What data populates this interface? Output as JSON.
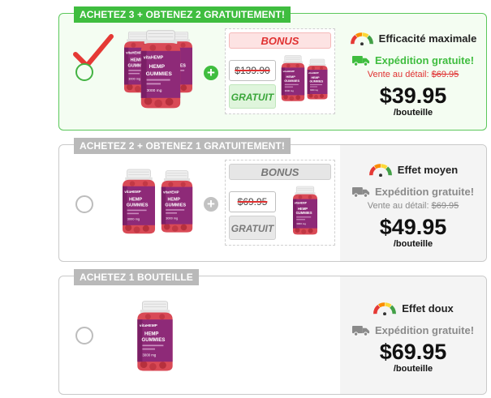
{
  "offers": [
    {
      "ribbon": "ACHETEZ 3 + OBTENEZ 2 GRATUITEMENT!",
      "selected": true,
      "bonus_label": "BONUS",
      "strike_price": "$139.90",
      "free_label": "GRATUIT",
      "effect": "Efficacité maximale",
      "shipping": "Expédition gratuite!",
      "retail_prefix": "Vente au détail:",
      "retail_price": "$69.95",
      "price": "$39.95",
      "per": "/bouteille"
    },
    {
      "ribbon": "ACHETEZ 2 + OBTENEZ 1 GRATUITEMENT!",
      "selected": false,
      "bonus_label": "BONUS",
      "strike_price": "$69.95",
      "free_label": "GRATUIT",
      "effect": "Effet moyen",
      "shipping": "Expédition gratuite!",
      "retail_prefix": "Vente au détail:",
      "retail_price": "$69.95",
      "price": "$49.95",
      "per": "/bouteille"
    },
    {
      "ribbon": "ACHETEZ 1 BOUTEILLE",
      "selected": false,
      "effect": "Effet doux",
      "shipping": "Expédition gratuite!",
      "price": "$69.95",
      "per": "/bouteille"
    }
  ],
  "product": {
    "brand": "vitaHEMP",
    "line1": "HEMP",
    "line2": "GUMMIES",
    "dose": "3000 mg"
  },
  "icons": {
    "checkmark": "red-checkmark-icon",
    "plus": "plus-icon",
    "gauge": "gauge-icon",
    "truck": "delivery-truck-icon"
  },
  "colors": {
    "selected_green": "#3fbd3f",
    "bonus_red": "#e03131",
    "muted_gray": "#b9b9b9",
    "label_purple": "#8e2a78"
  }
}
